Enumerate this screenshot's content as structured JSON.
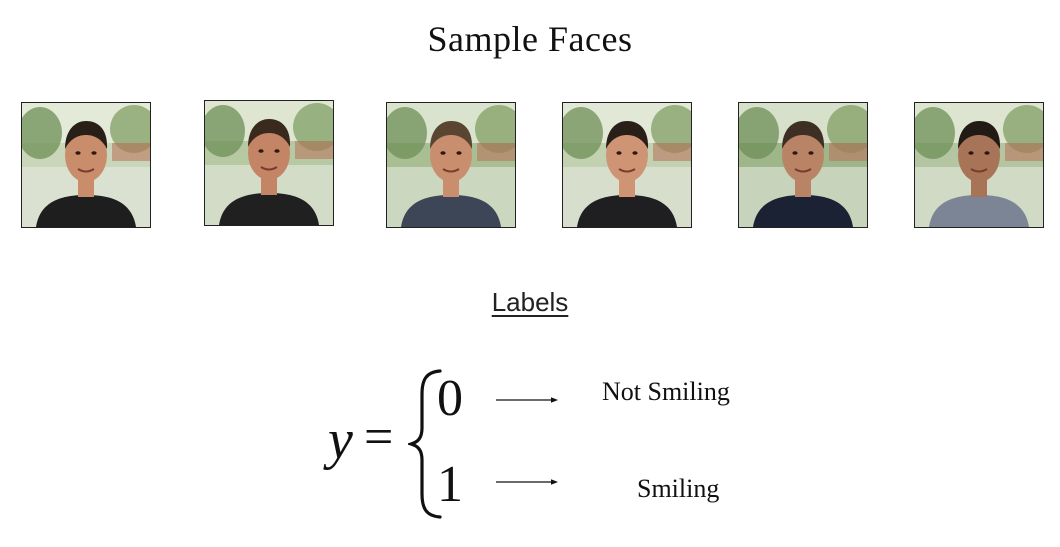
{
  "slide": {
    "title": "Sample Faces",
    "labels_heading": "Labels"
  },
  "faces": [
    {
      "alt": "Sample face photo 1",
      "shirt_color": "#1e1e1e",
      "skin": "#c98d6c",
      "hair": "#2a1f18",
      "bg": "#c9d6b9"
    },
    {
      "alt": "Sample face photo 2",
      "shirt_color": "#202020",
      "skin": "#c48466",
      "hair": "#3a2a1e",
      "bg": "#b7c9a3"
    },
    {
      "alt": "Sample face photo 3",
      "shirt_color": "#3c4656",
      "skin": "#c98e6e",
      "hair": "#5a4532",
      "bg": "#a9bf93"
    },
    {
      "alt": "Sample face photo 4",
      "shirt_color": "#1f1f22",
      "skin": "#cf9474",
      "hair": "#2a1f18",
      "bg": "#c2d1b0"
    },
    {
      "alt": "Sample face photo 5",
      "shirt_color": "#1b2233",
      "skin": "#b98466",
      "hair": "#3e2f24",
      "bg": "#9fb58a"
    },
    {
      "alt": "Sample face photo 6",
      "shirt_color": "#7c8596",
      "skin": "#a87458",
      "hair": "#221a15",
      "bg": "#b4c6a1"
    }
  ],
  "equation": {
    "variable": "y",
    "equals": "=",
    "cases": [
      {
        "value": "0",
        "meaning": "Not Smiling"
      },
      {
        "value": "1",
        "meaning": "Smiling"
      }
    ]
  }
}
